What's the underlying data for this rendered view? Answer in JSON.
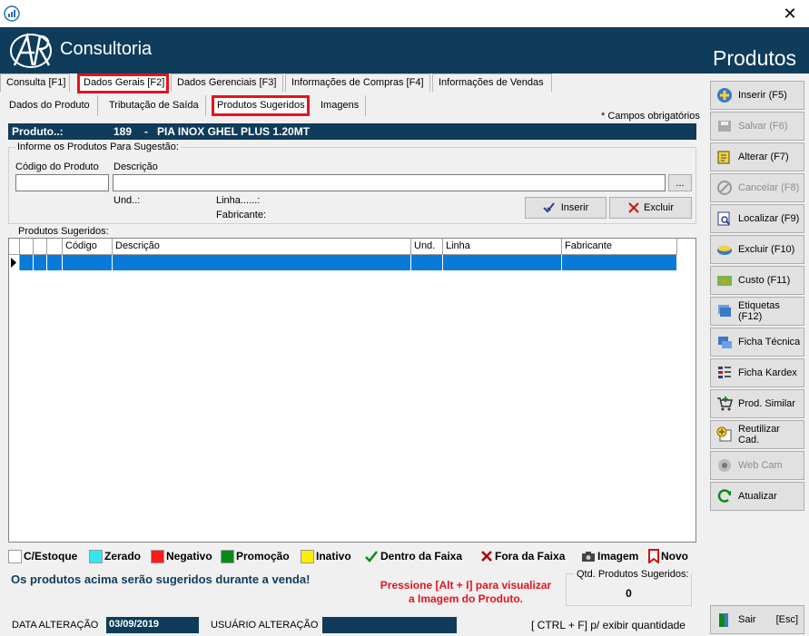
{
  "header": {
    "logo_text": "Consultoria",
    "page_heading": "Produtos"
  },
  "tabs_main": [
    "Consulta [F1]",
    "Dados Gerais [F2]",
    "Dados Gerenciais [F3]",
    "Informações de Compras [F4]",
    "Informações de Vendas"
  ],
  "tabs_sub": [
    "Dados do Produto",
    "Tributação de Saída",
    "Produtos Sugeridos",
    "Imagens"
  ],
  "required_note": "* Campos obrigatórios",
  "product_bar": {
    "label": "Produto..:",
    "code": "189",
    "separator": "-",
    "name": "PIA INOX GHEL PLUS 1.20MT"
  },
  "suggest_group": {
    "title": "Informe os Produtos Para Sugestão:",
    "code_label": "Código do Produto",
    "desc_label": "Descrição",
    "code_value": "",
    "desc_value": "",
    "ellipsis": "...",
    "und_label": "Und..:",
    "linha_label": "Linha......:",
    "fabricante_label": "Fabricante:",
    "insert_label": "Inserir",
    "delete_label": "Excluir"
  },
  "grid": {
    "title": "Produtos Sugeridos:",
    "columns": [
      "Código",
      "Descrição",
      "Und.",
      "Linha",
      "Fabricante"
    ]
  },
  "legend": [
    {
      "label": "C/Estoque",
      "color": "#ffffff"
    },
    {
      "label": "Zerado",
      "color": "#33e6f0"
    },
    {
      "label": "Negativo",
      "color": "#ff1a1a"
    },
    {
      "label": "Promoção",
      "color": "#0a8a14"
    },
    {
      "label": "Inativo",
      "color": "#ffee00"
    },
    {
      "label": "Dentro da Faixa",
      "icon": "check-icon"
    },
    {
      "label": "Fora da Faixa",
      "icon": "cross-icon"
    },
    {
      "label": "Imagem",
      "icon": "camera-icon"
    },
    {
      "label": "Novo",
      "icon": "bookmark-icon"
    }
  ],
  "info": {
    "suggest_note": "Os produtos acima serão sugeridos durante a venda!",
    "image_hint_line1": "Pressione [Alt + I] para visualizar",
    "image_hint_line2": "a Imagem do Produto.",
    "qty_label": "Qtd. Produtos Sugeridos:",
    "qty_value": "0"
  },
  "footer": {
    "date_label": "DATA ALTERAÇÃO",
    "date_value": "03/09/2019",
    "user_label": "USUÁRIO ALTERAÇÃO",
    "user_value": "",
    "shortcut_hint": "[ CTRL + F] p/ exibir quantidade"
  },
  "sidebar": [
    {
      "label": "Inserir (F5)",
      "icon": "plus-icon",
      "enabled": true
    },
    {
      "label": "Salvar (F6)",
      "icon": "save-icon",
      "enabled": false
    },
    {
      "label": "Alterar (F7)",
      "icon": "edit-icon",
      "enabled": true
    },
    {
      "label": "Cancelar (F8)",
      "icon": "cancel-icon",
      "enabled": false
    },
    {
      "label": "Localizar (F9)",
      "icon": "search-icon",
      "enabled": true
    },
    {
      "label": "Excluir (F10)",
      "icon": "delete-icon",
      "enabled": true
    },
    {
      "label": "Custo (F11)",
      "icon": "money-icon",
      "enabled": true
    },
    {
      "label": "Etiquetas (F12)",
      "icon": "label-icon",
      "enabled": true
    },
    {
      "label": "Ficha Técnica",
      "icon": "sheet-icon",
      "enabled": true
    },
    {
      "label": "Ficha Kardex",
      "icon": "kardex-icon",
      "enabled": true
    },
    {
      "label": "Prod. Similar",
      "icon": "cart-icon",
      "enabled": true
    },
    {
      "label": "Reutilizar Cad.",
      "icon": "reuse-icon",
      "enabled": true
    },
    {
      "label": "Web Cam",
      "icon": "webcam-icon",
      "enabled": false
    },
    {
      "label": "Atualizar",
      "icon": "refresh-icon",
      "enabled": true
    }
  ],
  "exit_button": {
    "label": "Sair",
    "shortcut": "[Esc]"
  }
}
